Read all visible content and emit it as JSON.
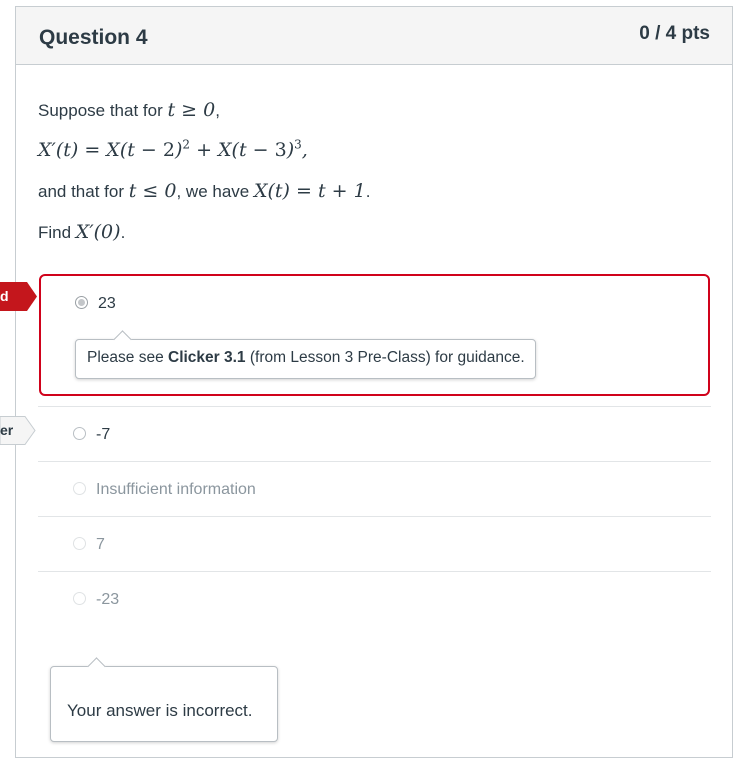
{
  "question": {
    "title": "Question 4",
    "points": "0 / 4 pts",
    "text": {
      "line1_prefix": "Suppose that for ",
      "line1_math": "t ≥ 0",
      "line1_suffix": ",",
      "line3_prefix": "and that for ",
      "line3_math": "t ≤ 0",
      "line3_mid": ", we have ",
      "line3_math2": "X(t) = t + 1",
      "line3_suffix": ".",
      "line4_prefix": "Find ",
      "line4_math": "X′(0)",
      "line4_suffix": "."
    }
  },
  "answers": [
    {
      "label": "23",
      "selected": true,
      "state": "incorrect"
    },
    {
      "label": "-7",
      "selected": false,
      "state": "correct"
    },
    {
      "label": "Insufficient information",
      "selected": false
    },
    {
      "label": "7",
      "selected": false
    },
    {
      "label": "-23",
      "selected": false
    }
  ],
  "answer_comment": {
    "prefix": "Please see ",
    "bold": "Clicker 3.1",
    "suffix": " (from Lesson 3 Pre-Class) for guidance."
  },
  "side_tags": {
    "you_answered": "d",
    "correct_answer": "er"
  },
  "feedback": "Your answer is incorrect.",
  "colors": {
    "incorrect": "#d0021b",
    "header_bg": "#f5f5f5",
    "text": "#2d3b45",
    "muted": "#8b969e"
  }
}
